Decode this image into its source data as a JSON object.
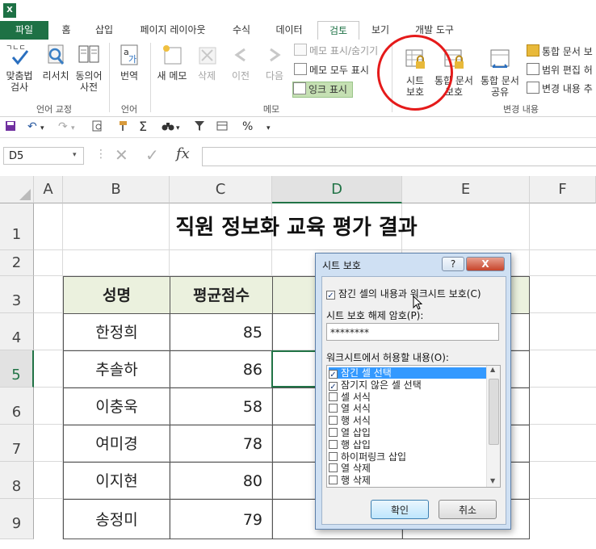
{
  "ribbon_tabs": [
    "파일",
    "홈",
    "삽입",
    "페이지 레이아웃",
    "수식",
    "데이터",
    "검토",
    "보기",
    "개발 도구"
  ],
  "ribbon": {
    "spell_label": "맞춤법\n검사",
    "research_label": "리서치",
    "thesaurus_label": "동의어\n사전",
    "group_language_proof": "언어 교정",
    "translate_label": "번역",
    "group_language": "언어",
    "new_comment": "새 메모",
    "delete_comment": "삭제",
    "prev_comment": "이전",
    "next_comment": "다음",
    "show_hide_comment": "메모 표시/숨기기",
    "show_all_comments": "메모 모두 표시",
    "show_ink": "잉크 표시",
    "group_comments": "메모",
    "protect_sheet": "시트\n보호",
    "protect_workbook": "통합 문서\n보호",
    "share_workbook": "통합 문서\n공유",
    "protect_share_workbook": "통합 문서 보",
    "allow_edit_ranges": "범위 편집 허",
    "track_changes": "변경 내용 추",
    "group_changes": "변경 내용",
    "pre_small_label": "ㄱㄴㄷ"
  },
  "qat": {
    "percent": "%"
  },
  "namebox": "D5",
  "fx_label": "fx",
  "columns": [
    "A",
    "B",
    "C",
    "D",
    "E",
    "F"
  ],
  "rows": [
    "1",
    "2",
    "3",
    "4",
    "5",
    "6",
    "7",
    "8",
    "9"
  ],
  "sheet": {
    "title": "직원 정보화 교육 평가 결과",
    "header_name": "성명",
    "header_score": "평균점수",
    "records": [
      {
        "name": "한정희",
        "score": "85"
      },
      {
        "name": "추솔하",
        "score": "86"
      },
      {
        "name": "이충욱",
        "score": "58"
      },
      {
        "name": "여미경",
        "score": "78"
      },
      {
        "name": "이지현",
        "score": "80"
      },
      {
        "name": "송정미",
        "score": "79"
      }
    ]
  },
  "dialog": {
    "title": "시트 보호",
    "help": "?",
    "close": "X",
    "protect_check": "잠긴 셀의 내용과 워크시트 보호(C)",
    "password_label": "시트 보호 해제 암호(P):",
    "password_value": "********",
    "allow_label": "워크시트에서 허용할 내용(O):",
    "options": [
      {
        "label": "잠긴 셀 선택",
        "checked": true
      },
      {
        "label": "잠기지 않은 셀 선택",
        "checked": true
      },
      {
        "label": "셀 서식",
        "checked": false
      },
      {
        "label": "열 서식",
        "checked": false
      },
      {
        "label": "행 서식",
        "checked": false
      },
      {
        "label": "열 삽입",
        "checked": false
      },
      {
        "label": "행 삽입",
        "checked": false
      },
      {
        "label": "하이퍼링크 삽입",
        "checked": false
      },
      {
        "label": "열 삭제",
        "checked": false
      },
      {
        "label": "행 삭제",
        "checked": false
      }
    ],
    "ok": "확인",
    "cancel": "취소"
  },
  "colors": {
    "excel_green": "#1e7145",
    "header_fill": "#ebf1de",
    "highlight_circle": "#e51a1a",
    "list_selection": "#3399ff"
  }
}
